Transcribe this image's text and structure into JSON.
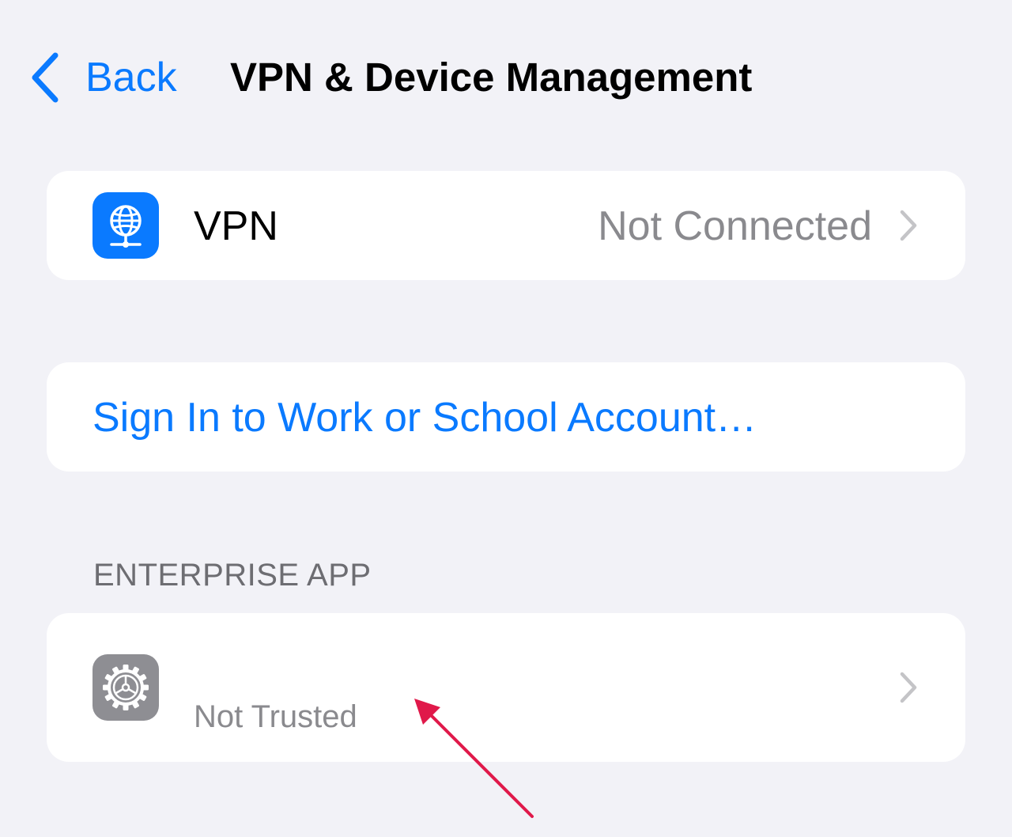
{
  "nav": {
    "back_label": "Back",
    "title": "VPN & Device Management"
  },
  "vpn_row": {
    "icon": "globe-network-icon",
    "label": "VPN",
    "status": "Not Connected"
  },
  "sign_in": {
    "label": "Sign In to Work or School Account…"
  },
  "enterprise_section": {
    "header": "ENTERPRISE APP",
    "app": {
      "icon": "settings-gear-icon",
      "status": "Not Trusted"
    }
  },
  "colors": {
    "background": "#F2F2F7",
    "accent": "#0A7AFF",
    "annotation_arrow": "#E0194A"
  }
}
